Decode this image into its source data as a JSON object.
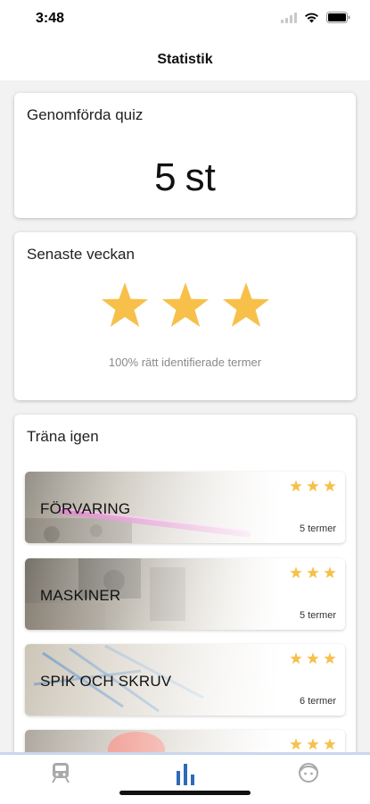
{
  "status_bar": {
    "time": "3:48"
  },
  "nav": {
    "title": "Statistik"
  },
  "colors": {
    "star": "#f7c04a",
    "tab_active": "#2d6bb8",
    "tab_inactive": "#a9a9a9"
  },
  "quiz_card": {
    "title": "Genomförda quiz",
    "value": "5",
    "unit": "st"
  },
  "week_card": {
    "title": "Senaste veckan",
    "stars": 3,
    "caption": "100% rätt identifierade termer"
  },
  "train_card": {
    "title": "Träna igen",
    "topics": [
      {
        "name": "FÖRVARING",
        "stars": 3,
        "count": "5 termer"
      },
      {
        "name": "MASKINER",
        "stars": 3,
        "count": "5 termer"
      },
      {
        "name": "SPIK OCH SKRUV",
        "stars": 3,
        "count": "6 termer"
      },
      {
        "name": "",
        "stars": 3,
        "count": ""
      }
    ]
  },
  "tab_bar": {
    "tabs": [
      {
        "icon": "train-icon",
        "active": false
      },
      {
        "icon": "bar-chart-icon",
        "active": true
      },
      {
        "icon": "face-icon",
        "active": false
      }
    ]
  }
}
